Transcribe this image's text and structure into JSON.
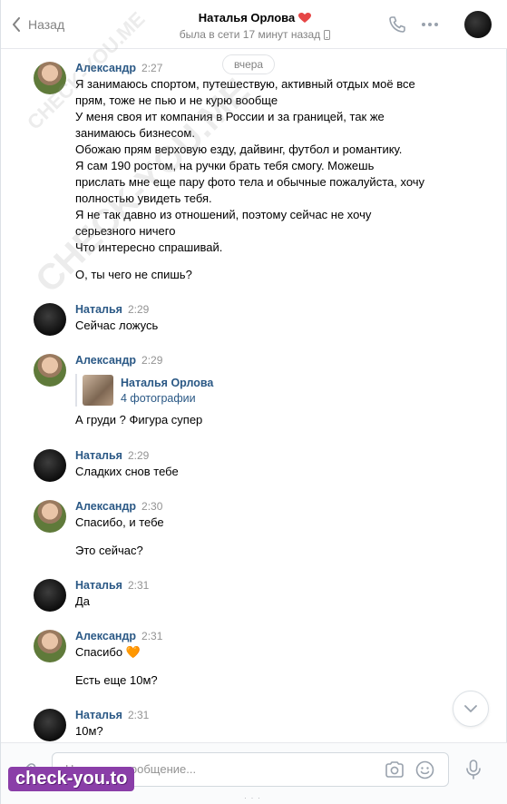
{
  "header": {
    "back_label": "Назад",
    "contact_name": "Наталья Орлова",
    "status": "была в сети 17 минут назад"
  },
  "date_divider": "вчера",
  "messages": [
    {
      "author": "Александр",
      "time": "2:27",
      "lines": [
        "Я занимаюсь спортом, путешествую, активный отдых моё все",
        "прям, тоже не пью и не курю вообще",
        "У меня своя ит компания в России и за границей, так же",
        "занимаюсь бизнесом.",
        "Обожаю прям верховую езду, дайвинг, футбол и романтику.",
        "Я сам 190 ростом, на ручки брать тебя смогу. Можешь",
        "прислать мне еще пару фото тела и обычные пожалуйста, хочу",
        "полностью увидеть тебя.",
        "Я не так давно из отношений, поэтому сейчас не хочу",
        "серьезного ничего",
        "Что интересно спрашивай.",
        "",
        "О, ты чего не спишь?"
      ]
    },
    {
      "author": "Наталья",
      "time": "2:29",
      "lines": [
        "Сейчас ложусь"
      ]
    },
    {
      "author": "Александр",
      "time": "2:29",
      "attachment": {
        "title": "Наталья Орлова",
        "subtitle": "4 фотографии"
      },
      "lines": [
        "А груди ? Фигура супер"
      ]
    },
    {
      "author": "Наталья",
      "time": "2:29",
      "lines": [
        "Сладких снов тебе"
      ]
    },
    {
      "author": "Александр",
      "time": "2:30",
      "lines": [
        "Спасибо, и тебе",
        "",
        "Это сейчас?"
      ]
    },
    {
      "author": "Наталья",
      "time": "2:31",
      "lines": [
        "Да"
      ]
    },
    {
      "author": "Александр",
      "time": "2:31",
      "lines": [
        "Спасибо 🧡",
        "",
        "Есть еще 10м?"
      ]
    },
    {
      "author": "Наталья",
      "time": "2:31",
      "lines": [
        "10м?"
      ]
    }
  ],
  "composer": {
    "placeholder": "Напишите сообщение..."
  },
  "watermarks": {
    "diagonal": "CHECK-YOU.ME",
    "badge": "check-you.to"
  },
  "colors": {
    "link": "#2a5885",
    "muted": "#828282",
    "accent_heart": "#e64646"
  },
  "icons": [
    "back-chevron-icon",
    "heart-icon",
    "phone-icon",
    "more-icon",
    "mobile-icon",
    "paperclip-icon",
    "camera-icon",
    "smile-icon",
    "microphone-icon",
    "chevron-down-icon"
  ]
}
